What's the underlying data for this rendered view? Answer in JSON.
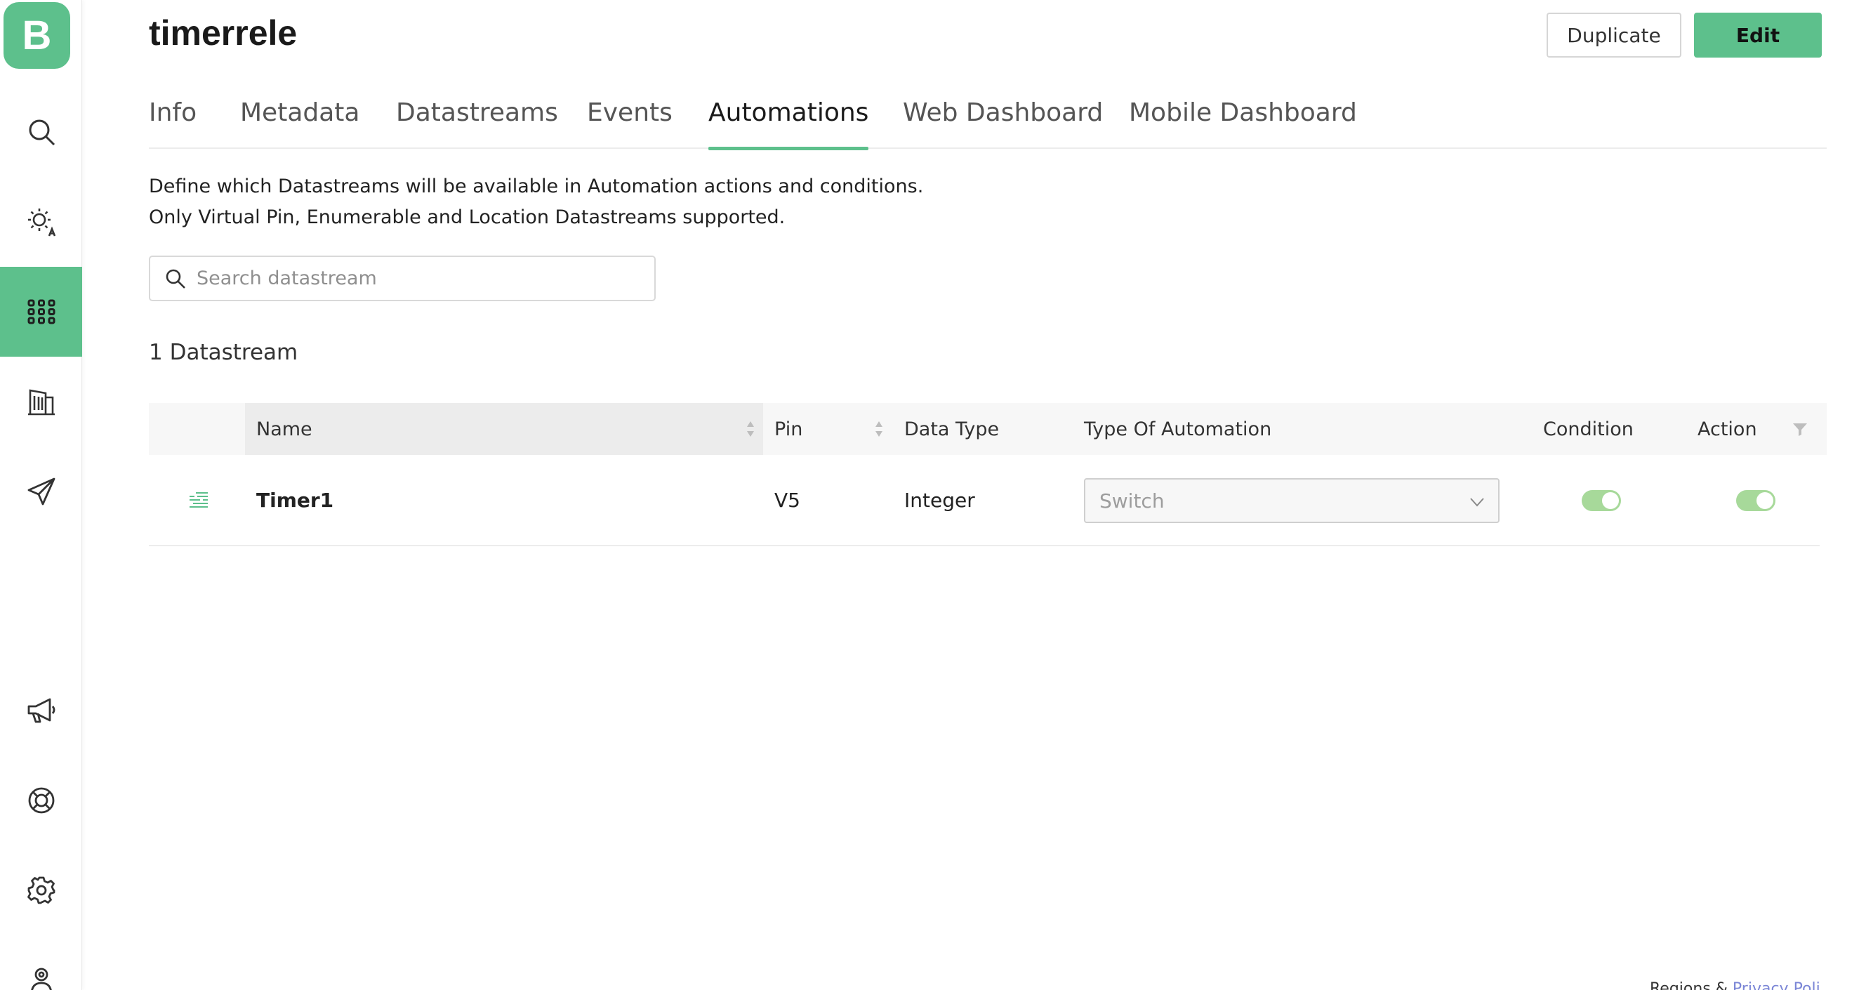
{
  "app": {
    "logo_letter": "B"
  },
  "header": {
    "title": "timerrele",
    "duplicate_label": "Duplicate",
    "edit_label": "Edit"
  },
  "tabs": [
    {
      "label": "Info"
    },
    {
      "label": "Metadata"
    },
    {
      "label": "Datastreams"
    },
    {
      "label": "Events"
    },
    {
      "label": "Automations",
      "active": true
    },
    {
      "label": "Web Dashboard"
    },
    {
      "label": "Mobile Dashboard"
    }
  ],
  "description": {
    "line1": "Define which Datastreams will be available in Automation actions and conditions.",
    "line2": "Only Virtual Pin, Enumerable and Location Datastreams supported."
  },
  "search": {
    "placeholder": "Search datastream",
    "value": ""
  },
  "count_label": "1 Datastream",
  "table": {
    "headers": {
      "name": "Name",
      "pin": "Pin",
      "data_type": "Data Type",
      "type_of_automation": "Type Of Automation",
      "condition": "Condition",
      "action": "Action"
    },
    "rows": [
      {
        "name": "Timer1",
        "pin": "V5",
        "data_type": "Integer",
        "type_of_automation": "Switch",
        "condition_enabled": true,
        "action_enabled": true
      }
    ]
  },
  "sidebar": {
    "items": [
      {
        "icon": "search-icon"
      },
      {
        "icon": "sun-auto-icon"
      },
      {
        "icon": "grid-icon",
        "active": true
      },
      {
        "icon": "building-icon"
      },
      {
        "icon": "paper-plane-icon"
      },
      {
        "icon": "megaphone-icon"
      },
      {
        "icon": "lifebuoy-icon"
      },
      {
        "icon": "gear-icon"
      },
      {
        "icon": "user-icon"
      }
    ]
  },
  "footer": {
    "text": "Regions & ",
    "link": "Privacy Poli"
  },
  "colors": {
    "accent": "#5dc08c",
    "toggle_on": "#a7d99a",
    "link": "#7b86d6"
  }
}
